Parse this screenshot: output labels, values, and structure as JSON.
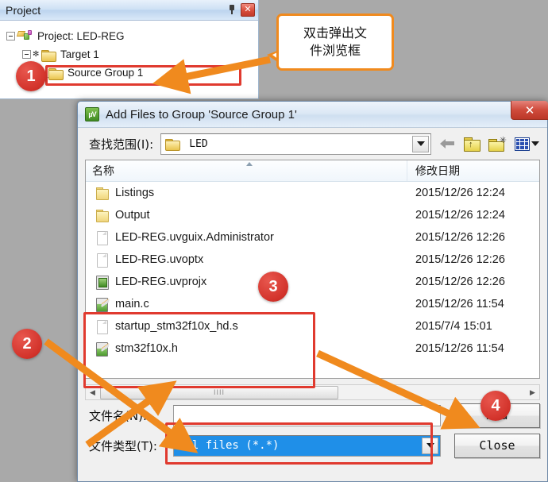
{
  "project_panel": {
    "title": "Project",
    "pin_icon": "pin-icon",
    "close_icon": "close-icon",
    "tree": [
      {
        "label": "Project: LED-REG",
        "icon": "project-icon",
        "level": 1
      },
      {
        "label": "Target 1",
        "icon": "folder-icon",
        "level": 2
      },
      {
        "label": "Source Group 1",
        "icon": "folder-icon",
        "level": 3
      }
    ]
  },
  "callout": {
    "line1": "双击弹出文",
    "line2": "件浏览框"
  },
  "badges": [
    "1",
    "2",
    "3",
    "4"
  ],
  "dialog": {
    "app_icon": "uvision-icon",
    "title": "Add Files to Group 'Source Group 1'",
    "close_label": "✕",
    "lookin": {
      "label": "查找范围(I):",
      "value": "LED",
      "folder_icon": "folder-icon",
      "dropdown_icon": "chevron-down-icon"
    },
    "toolbar": {
      "back_icon": "back-arrow-icon",
      "up_icon": "up-folder-icon",
      "new_folder_icon": "new-folder-icon",
      "views_icon": "views-grid-icon",
      "views_caret_icon": "chevron-down-icon"
    },
    "filelist": {
      "columns": [
        "名称",
        "修改日期"
      ],
      "rows": [
        {
          "name": "Listings",
          "date": "2015/12/26 12:24",
          "icon": "folder-icon"
        },
        {
          "name": "Output",
          "date": "2015/12/26 12:24",
          "icon": "folder-icon"
        },
        {
          "name": "LED-REG.uvguix.Administrator",
          "date": "2015/12/26 12:26",
          "icon": "document-icon"
        },
        {
          "name": "LED-REG.uvoptx",
          "date": "2015/12/26 12:26",
          "icon": "document-icon"
        },
        {
          "name": "LED-REG.uvprojx",
          "date": "2015/12/26 12:26",
          "icon": "project-file-icon"
        },
        {
          "name": "main.c",
          "date": "2015/12/26 11:54",
          "icon": "source-file-icon"
        },
        {
          "name": "startup_stm32f10x_hd.s",
          "date": "2015/7/4 15:01",
          "icon": "document-icon"
        },
        {
          "name": "stm32f10x.h",
          "date": "2015/12/26 11:54",
          "icon": "source-file-icon"
        }
      ]
    },
    "scrollbar": {
      "left_arrow_icon": "chevron-left-icon",
      "right_arrow_icon": "chevron-right-icon",
      "grip": "IIII"
    },
    "filename": {
      "label": "文件名(N):",
      "value": "",
      "placeholder": ""
    },
    "filetype": {
      "label": "文件类型(T):",
      "value": "All files (*.*)",
      "dropdown_icon": "chevron-down-icon"
    },
    "buttons": {
      "add": "Add",
      "close": "Close"
    }
  },
  "colors": {
    "badge_red": "#d2322a",
    "highlight_red": "#e03a2f",
    "arrow_orange": "#f08a1e",
    "selection_blue": "#1f8fe8"
  }
}
